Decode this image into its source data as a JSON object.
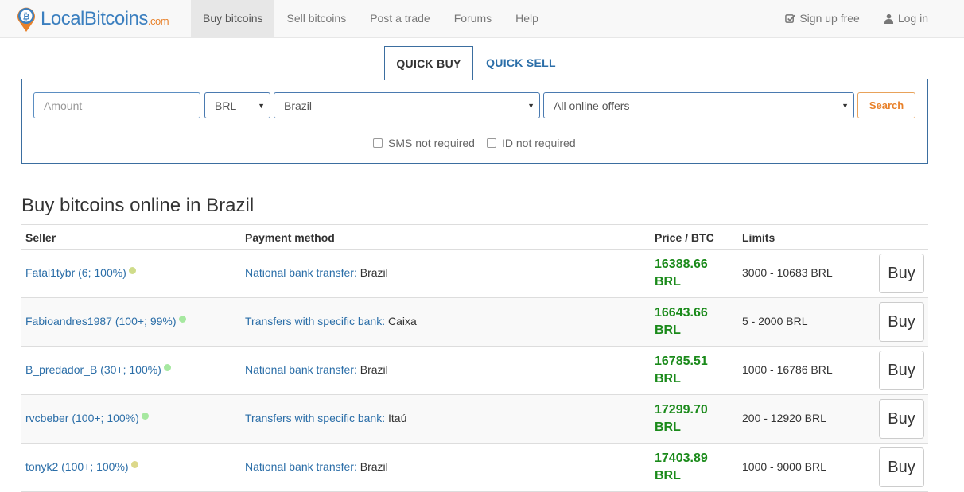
{
  "brand": {
    "name_main": "LocalBitcoins",
    "name_suffix": ".com"
  },
  "nav": {
    "items": [
      "Buy bitcoins",
      "Sell bitcoins",
      "Post a trade",
      "Forums",
      "Help"
    ],
    "signup": "Sign up free",
    "login": "Log in"
  },
  "quick": {
    "tab_buy": "QUICK BUY",
    "tab_sell": "QUICK SELL",
    "amount_placeholder": "Amount",
    "currency": "BRL",
    "country": "Brazil",
    "offers": "All online offers",
    "search": "Search",
    "sms": "SMS not required",
    "id": "ID not required"
  },
  "heading": "Buy bitcoins online in Brazil",
  "table": {
    "headers": {
      "seller": "Seller",
      "payment": "Payment method",
      "price": "Price / BTC",
      "limits": "Limits"
    },
    "buy_label": "Buy",
    "rows": [
      {
        "seller": "Fatal1tybr (6; 100%)",
        "status_color": "#cfdc8a",
        "method": "National bank transfer:",
        "detail": " Brazil",
        "price": "16388.66",
        "unit": "BRL",
        "limits": "3000 - 10683 BRL"
      },
      {
        "seller": "Fabioandres1987 (100+; 99%)",
        "status_color": "#a6e8a0",
        "method": "Transfers with specific bank:",
        "detail": " Caixa",
        "price": "16643.66",
        "unit": "BRL",
        "limits": "5 - 2000 BRL"
      },
      {
        "seller": "B_predador_B (30+; 100%)",
        "status_color": "#a6e8a0",
        "method": "National bank transfer:",
        "detail": " Brazil",
        "price": "16785.51",
        "unit": "BRL",
        "limits": "1000 - 16786 BRL"
      },
      {
        "seller": "rvcbeber (100+; 100%)",
        "status_color": "#a6e8a0",
        "method": "Transfers with specific bank:",
        "detail": " Itaú",
        "price": "17299.70",
        "unit": "BRL",
        "limits": "200 - 12920 BRL"
      },
      {
        "seller": "tonyk2 (100+; 100%)",
        "status_color": "#dcd88a",
        "method": "National bank transfer:",
        "detail": " Brazil",
        "price": "17403.89",
        "unit": "BRL",
        "limits": "1000 - 9000 BRL"
      }
    ]
  }
}
